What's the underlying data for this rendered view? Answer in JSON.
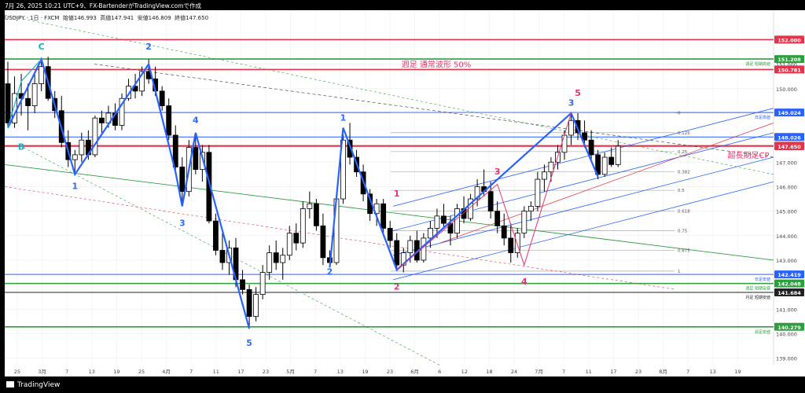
{
  "header": {
    "text": "7月 26, 2025 10:21 UTC+9、FX-BartenderがTradingView.comで作成"
  },
  "symbol": {
    "text": "USDJPY · 1日 · FXCM",
    "open": "始値146.993",
    "high": "高値147.941",
    "low": "安値146.809",
    "close": "終値147.650"
  },
  "brand": "TradingView",
  "colors": {
    "up": "#ffffff",
    "down": "#000000",
    "wave": "#2962ff",
    "wave_label": "#2f6bff",
    "pink": "#e8336d",
    "red_line": "#e0354a",
    "green_line": "#2e9e3f",
    "cyan_label": "#12b3c9"
  },
  "chart_data": {
    "type": "candlestick",
    "x_ticks": [
      "25",
      "3月",
      "7",
      "13",
      "19",
      "25",
      "4月",
      "7",
      "11",
      "17",
      "23",
      "5月",
      "7",
      "13",
      "19",
      "23",
      "6月",
      "6",
      "12",
      "18",
      "24",
      "7月",
      "7",
      "11",
      "17",
      "23",
      "8月",
      "7",
      "13",
      "19"
    ],
    "y_ticks": [
      "152.000",
      "151.000",
      "150.000",
      "149.000",
      "148.000",
      "147.000",
      "146.000",
      "145.000",
      "144.000",
      "143.000",
      "142.000",
      "141.000",
      "140.000",
      "139.000"
    ],
    "ylim": [
      138.7,
      153.2
    ],
    "price_tags": [
      {
        "value": 152.0,
        "label": "152.000",
        "color": "#e0354a",
        "note": ""
      },
      {
        "value": 151.208,
        "label": "151.208",
        "color": "#2e9e3f",
        "note": "週足 短期高値"
      },
      {
        "value": 150.781,
        "label": "150.781",
        "color": "#e0354a",
        "note": ""
      },
      {
        "value": 149.024,
        "label": "149.024",
        "color": "#2962ff",
        "note": "日足高値"
      },
      {
        "value": 148.026,
        "label": "148.026",
        "color": "#2962ff",
        "note": ""
      },
      {
        "value": 147.67,
        "label": "147.670",
        "color": "#e0354a",
        "note": ""
      },
      {
        "value": 147.65,
        "label": "147.650",
        "color": "#e0354a",
        "note": ""
      },
      {
        "value": 142.419,
        "label": "142.419",
        "color": "#2962ff",
        "note": "日足安値"
      },
      {
        "value": 142.048,
        "label": "142.048",
        "color": "#2e9e3f",
        "note": "週足 短期安値"
      },
      {
        "value": 141.684,
        "label": "141.684",
        "color": "#222222",
        "note": "月足 短期安値"
      },
      {
        "value": 140.279,
        "label": "140.279",
        "color": "#2e9e3f",
        "note": "週足安値"
      }
    ],
    "fib_levels": [
      {
        "ratio": "0",
        "value": 149.02
      },
      {
        "ratio": "0.125",
        "value": 148.2
      },
      {
        "ratio": "0.25",
        "value": 147.43
      },
      {
        "ratio": "0.382",
        "value": 146.6
      },
      {
        "ratio": "0.5",
        "value": 145.85
      },
      {
        "ratio": "0.618",
        "value": 145.0
      },
      {
        "ratio": "0.75",
        "value": 144.2
      },
      {
        "ratio": "0.875",
        "value": 143.4
      },
      {
        "ratio": "1",
        "value": 142.55
      }
    ],
    "annotations": [
      {
        "text": "週足 通常波形 50%",
        "color": "#e8336d"
      },
      {
        "text": "超長期足CP",
        "color": "#e8336d"
      }
    ],
    "candles": [
      [
        150.2,
        151.1,
        148.4,
        148.6
      ],
      [
        148.6,
        150.5,
        148.4,
        149.8
      ],
      [
        149.8,
        150.6,
        148.9,
        149.6
      ],
      [
        149.6,
        150.2,
        148.3,
        149.3
      ],
      [
        149.3,
        150.6,
        149.0,
        150.2
      ],
      [
        150.2,
        151.2,
        149.9,
        150.9
      ],
      [
        150.9,
        151.3,
        149.5,
        149.6
      ],
      [
        149.6,
        149.9,
        148.8,
        149.1
      ],
      [
        149.1,
        149.7,
        147.6,
        147.8
      ],
      [
        147.8,
        148.3,
        146.8,
        147.1
      ],
      [
        147.1,
        147.5,
        146.5,
        147.3
      ],
      [
        147.3,
        148.2,
        147.0,
        147.9
      ],
      [
        147.9,
        148.3,
        147.1,
        147.3
      ],
      [
        147.3,
        148.9,
        147.2,
        148.8
      ],
      [
        148.8,
        149.1,
        148.2,
        148.6
      ],
      [
        148.6,
        149.3,
        148.4,
        149.0
      ],
      [
        149.0,
        149.4,
        148.3,
        148.5
      ],
      [
        148.5,
        149.8,
        148.3,
        149.6
      ],
      [
        149.6,
        150.4,
        149.5,
        150.1
      ],
      [
        150.1,
        150.6,
        149.6,
        149.9
      ],
      [
        149.9,
        150.9,
        149.7,
        150.7
      ],
      [
        150.7,
        151.2,
        150.2,
        150.4
      ],
      [
        150.4,
        150.9,
        149.7,
        149.9
      ],
      [
        149.9,
        150.1,
        149.1,
        149.3
      ],
      [
        149.3,
        149.6,
        147.9,
        148.1
      ],
      [
        148.1,
        148.5,
        146.5,
        146.8
      ],
      [
        146.8,
        147.2,
        145.2,
        145.8
      ],
      [
        145.8,
        147.9,
        145.6,
        147.6
      ],
      [
        147.6,
        148.2,
        146.5,
        146.7
      ],
      [
        146.7,
        147.7,
        146.2,
        147.4
      ],
      [
        147.4,
        147.7,
        144.5,
        144.6
      ],
      [
        144.6,
        144.9,
        143.2,
        143.4
      ],
      [
        143.4,
        144.1,
        142.6,
        142.9
      ],
      [
        142.9,
        143.8,
        142.4,
        143.5
      ],
      [
        143.5,
        143.9,
        141.9,
        142.2
      ],
      [
        142.2,
        142.6,
        141.6,
        141.8
      ],
      [
        141.8,
        142.0,
        140.3,
        140.7
      ],
      [
        140.7,
        141.9,
        140.5,
        141.6
      ],
      [
        141.6,
        142.8,
        141.4,
        142.5
      ],
      [
        142.5,
        143.6,
        142.2,
        143.3
      ],
      [
        143.3,
        143.8,
        142.6,
        142.9
      ],
      [
        142.9,
        143.5,
        142.2,
        143.2
      ],
      [
        143.2,
        144.4,
        143.0,
        144.1
      ],
      [
        144.1,
        144.5,
        143.4,
        143.7
      ],
      [
        143.7,
        145.4,
        143.5,
        145.1
      ],
      [
        145.1,
        145.8,
        144.7,
        145.3
      ],
      [
        145.3,
        145.5,
        144.2,
        144.4
      ],
      [
        144.4,
        144.9,
        142.8,
        143.1
      ],
      [
        143.1,
        143.4,
        142.7,
        142.9
      ],
      [
        142.9,
        145.6,
        142.8,
        145.5
      ],
      [
        145.5,
        148.4,
        145.3,
        147.9
      ],
      [
        147.9,
        148.6,
        146.9,
        147.2
      ],
      [
        147.2,
        147.5,
        146.4,
        146.6
      ],
      [
        146.6,
        146.9,
        145.4,
        145.7
      ],
      [
        145.7,
        145.9,
        144.6,
        144.9
      ],
      [
        144.9,
        145.5,
        144.4,
        145.3
      ],
      [
        145.3,
        145.5,
        144.0,
        144.3
      ],
      [
        144.3,
        144.6,
        143.5,
        143.8
      ],
      [
        143.8,
        144.1,
        142.6,
        142.8
      ],
      [
        142.8,
        143.5,
        142.5,
        143.3
      ],
      [
        143.3,
        144.0,
        142.9,
        143.8
      ],
      [
        143.8,
        144.2,
        142.9,
        143.0
      ],
      [
        143.0,
        144.1,
        142.9,
        143.9
      ],
      [
        143.9,
        144.6,
        143.5,
        144.3
      ],
      [
        144.3,
        145.1,
        143.9,
        144.8
      ],
      [
        144.8,
        145.3,
        144.3,
        144.5
      ],
      [
        144.5,
        144.8,
        143.6,
        144.1
      ],
      [
        144.1,
        145.3,
        143.9,
        145.1
      ],
      [
        145.1,
        145.6,
        144.5,
        144.7
      ],
      [
        144.7,
        145.7,
        144.6,
        145.5
      ],
      [
        145.5,
        146.3,
        145.2,
        146.0
      ],
      [
        146.0,
        146.7,
        145.6,
        145.8
      ],
      [
        145.8,
        146.2,
        144.7,
        145.0
      ],
      [
        145.0,
        145.4,
        144.1,
        144.4
      ],
      [
        144.4,
        144.9,
        143.6,
        143.9
      ],
      [
        143.9,
        144.5,
        142.9,
        143.3
      ],
      [
        143.3,
        144.3,
        143.1,
        144.1
      ],
      [
        144.1,
        145.2,
        143.9,
        145.0
      ],
      [
        145.0,
        145.4,
        144.6,
        145.2
      ],
      [
        145.2,
        146.6,
        145.0,
        146.3
      ],
      [
        146.3,
        146.9,
        145.8,
        146.6
      ],
      [
        146.6,
        147.2,
        146.2,
        147.0
      ],
      [
        147.0,
        147.7,
        146.7,
        147.4
      ],
      [
        147.4,
        148.3,
        147.1,
        148.1
      ],
      [
        148.1,
        149.0,
        147.7,
        148.7
      ],
      [
        148.7,
        149.0,
        147.9,
        148.2
      ],
      [
        148.2,
        148.7,
        147.6,
        147.9
      ],
      [
        147.9,
        148.3,
        147.1,
        147.3
      ],
      [
        147.3,
        147.5,
        146.3,
        146.5
      ],
      [
        146.5,
        147.4,
        146.4,
        147.2
      ],
      [
        147.2,
        147.6,
        146.8,
        146.9
      ],
      [
        146.9,
        147.9,
        146.8,
        147.65
      ]
    ]
  }
}
